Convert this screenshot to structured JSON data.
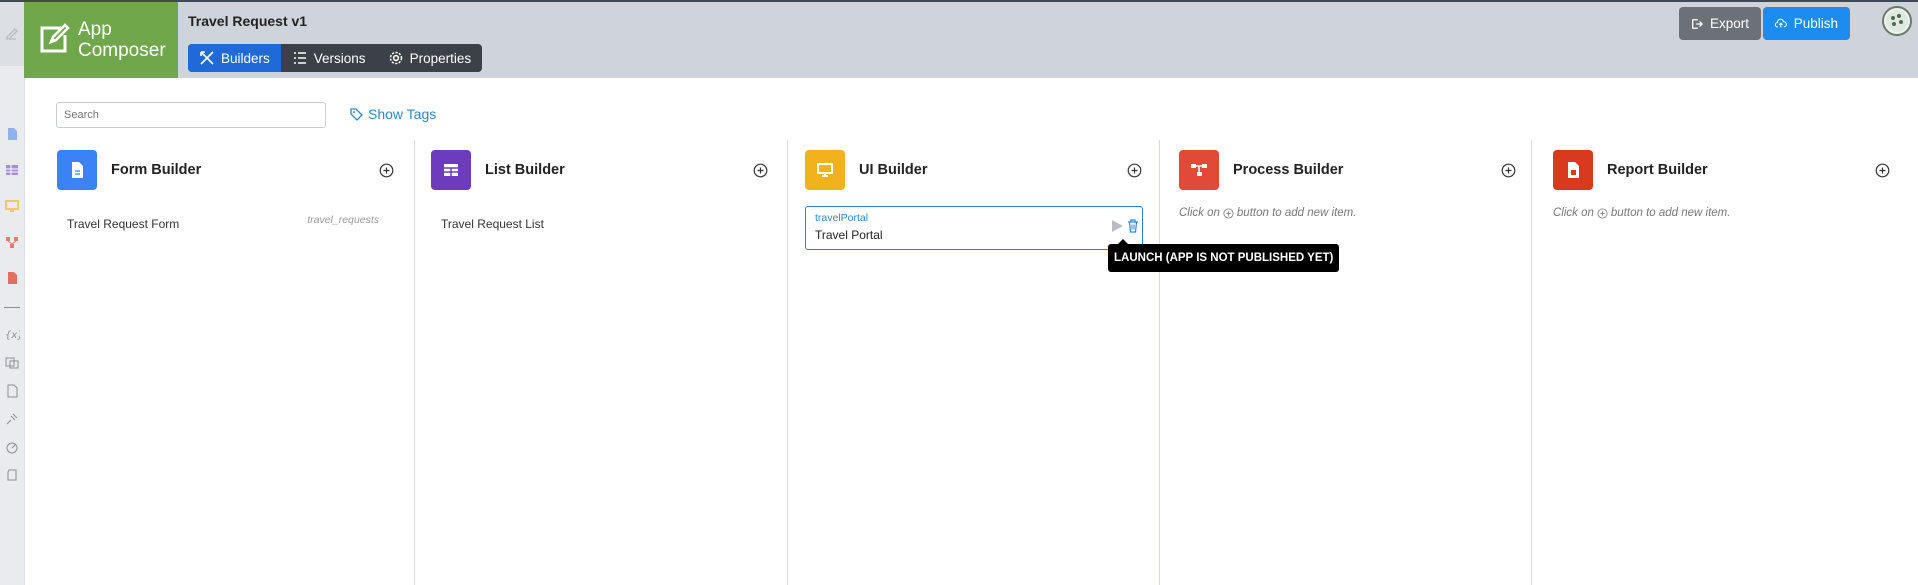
{
  "brand": {
    "line1": "App",
    "line2": "Composer"
  },
  "app": {
    "title": "Travel Request v1"
  },
  "tabs": [
    {
      "label": "Builders",
      "icon": "builders-icon",
      "active": true
    },
    {
      "label": "Versions",
      "icon": "list-icon",
      "active": false
    },
    {
      "label": "Properties",
      "icon": "gear-icon",
      "active": false
    }
  ],
  "actions": {
    "export_label": "Export",
    "publish_label": "Publish"
  },
  "search": {
    "placeholder": "Search"
  },
  "show_tags_label": "Show Tags",
  "columns": [
    {
      "title": "Form Builder",
      "color": "#3b82f6",
      "icon": "form-icon",
      "items": [
        {
          "label": "Travel Request Form",
          "tag": "travel_requests"
        }
      ]
    },
    {
      "title": "List Builder",
      "color": "#6d3bbd",
      "icon": "table-icon",
      "items": [
        {
          "label": "Travel Request List"
        }
      ]
    },
    {
      "title": "UI Builder",
      "color": "#f2b21b",
      "icon": "monitor-icon",
      "items": [
        {
          "id": "travelPortal",
          "label": "Travel Portal"
        }
      ]
    },
    {
      "title": "Process Builder",
      "color": "#e14a37",
      "icon": "process-icon",
      "hint_before": "Click on",
      "hint_after": "button to add new item."
    },
    {
      "title": "Report Builder",
      "color": "#d9391c",
      "icon": "report-icon",
      "hint_before": "Click on",
      "hint_after": "button to add new item."
    }
  ],
  "tooltip": "LAUNCH (APP IS NOT PUBLISHED YET)"
}
